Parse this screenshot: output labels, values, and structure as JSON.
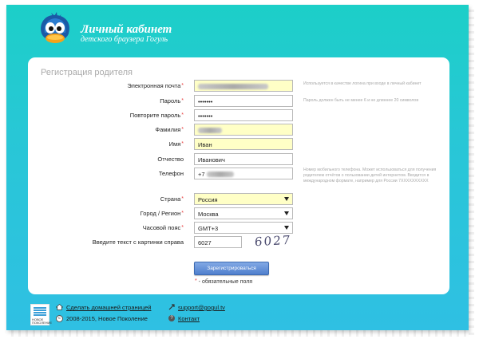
{
  "header": {
    "title": "Личный кабинет",
    "subtitle": "детского браузера Гогуль"
  },
  "form": {
    "title": "Регистрация родителя",
    "required_mark": "*",
    "email": {
      "label": "Электронная почта",
      "required": true,
      "value_masked": true,
      "hint": "Используется в качестве логина при входе в личный кабинет"
    },
    "password": {
      "label": "Пароль",
      "required": true,
      "value": "•••••••",
      "hint": "Пароль должен быть не менее 6 и не длиннее 20 символов"
    },
    "password_repeat": {
      "label": "Повторите пароль",
      "required": true,
      "value": "•••••••"
    },
    "surname": {
      "label": "Фамилия",
      "required": true,
      "value_masked": true
    },
    "name": {
      "label": "Имя",
      "required": true,
      "value": "Иван"
    },
    "patronymic": {
      "label": "Отчество",
      "required": false,
      "value": "Иванович"
    },
    "phone": {
      "label": "Телефон",
      "required": false,
      "value_prefix": "+7",
      "value_masked": true,
      "hint": "Номер мобильного телефона. Может использоваться для получения родителем отчётов о пользовании детей интернетом. Вводится в международном формате, например для России 7XXXXXXXXXX"
    },
    "country": {
      "label": "Страна",
      "required": true,
      "value": "Россия"
    },
    "city": {
      "label": "Город / Регион",
      "required": true,
      "value": "Москва"
    },
    "timezone": {
      "label": "Часовой пояс",
      "required": true,
      "value": "GMT+3"
    },
    "captcha": {
      "label": "Введите текст с картинки справа",
      "value": "6027",
      "image_text": "6027"
    },
    "submit_label": "Зарегистрироваться",
    "required_note": " - обязательные поля"
  },
  "footer": {
    "logo_text": "НОВОЕ ПОКОЛЕНИЕ",
    "homepage_link": "Сделать домашней страницей",
    "email_link": "support@gogul.tv",
    "copyright": "2008-2015, Новое Поколение",
    "contact_link": "Контакт"
  },
  "colors": {
    "background_gradient": [
      "#1ccfc8",
      "#2fc0e3"
    ],
    "required_field_bg": "#ffffc6",
    "required_mark": "#e83a3a",
    "button": "#4f7fcd"
  }
}
